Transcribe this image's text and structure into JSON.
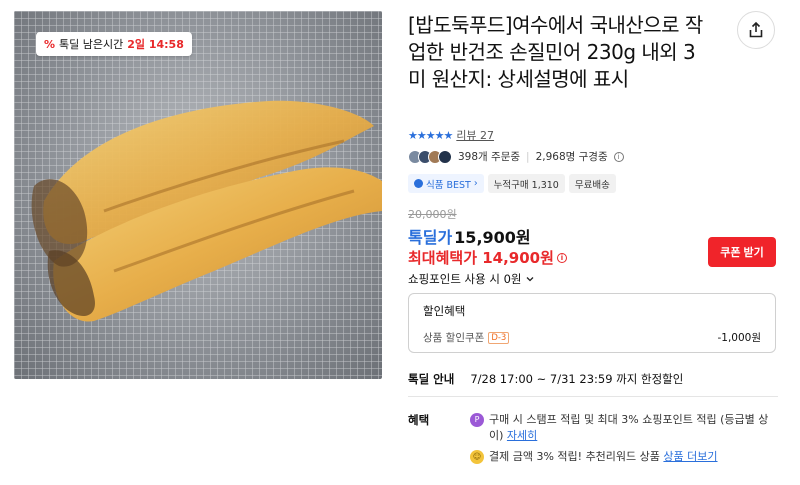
{
  "image": {
    "deal_timer": {
      "icon": "percent-icon",
      "label": "톡딜 남은시간",
      "time": "2일 14:58"
    }
  },
  "product": {
    "title": "[밥도둑푸드]여수에서 국내산으로 작업한 반건조 손질민어 230g 내외 3미 원산지: 상세설명에 표시",
    "rating_stars": "★★★★★",
    "review_link": "리뷰 27",
    "order_count": "398개 주문중",
    "subscriber_count": "2,968명 구경중",
    "tags": [
      "식품 BEST",
      "누적구매 1,310",
      "무료배송"
    ],
    "original_price": "20,000원",
    "deal_price_label": "톡딜가",
    "deal_price": "15,900원",
    "max_benefit": "최대혜택가 14,900원",
    "coupon_button": "쿠폰 받기",
    "points_label": "쇼핑포인트 사용 시 0원",
    "discount": {
      "head": "할인혜택",
      "item_label": "상품 할인쿠폰",
      "dday": "D-3",
      "amount": "-1,000원"
    },
    "deal_notice": {
      "label": "톡딜 안내",
      "text": "7/28 17:00 ~ 7/31 23:59 까지 한정할인"
    },
    "benefit": {
      "label": "혜택",
      "item1_text": "구매 시 스탬프 적립 및 최대 3% 쇼핑포인트 적립 (등급별 상이)",
      "item1_link": "자세히",
      "item2_text": "결제 금액 3% 적립! 추천리워드 상품",
      "item2_link": "상품 더보기"
    }
  },
  "colors": {
    "accent_blue": "#2a6fdb",
    "accent_red": "#e8292b",
    "coupon_red": "#f0242a"
  }
}
